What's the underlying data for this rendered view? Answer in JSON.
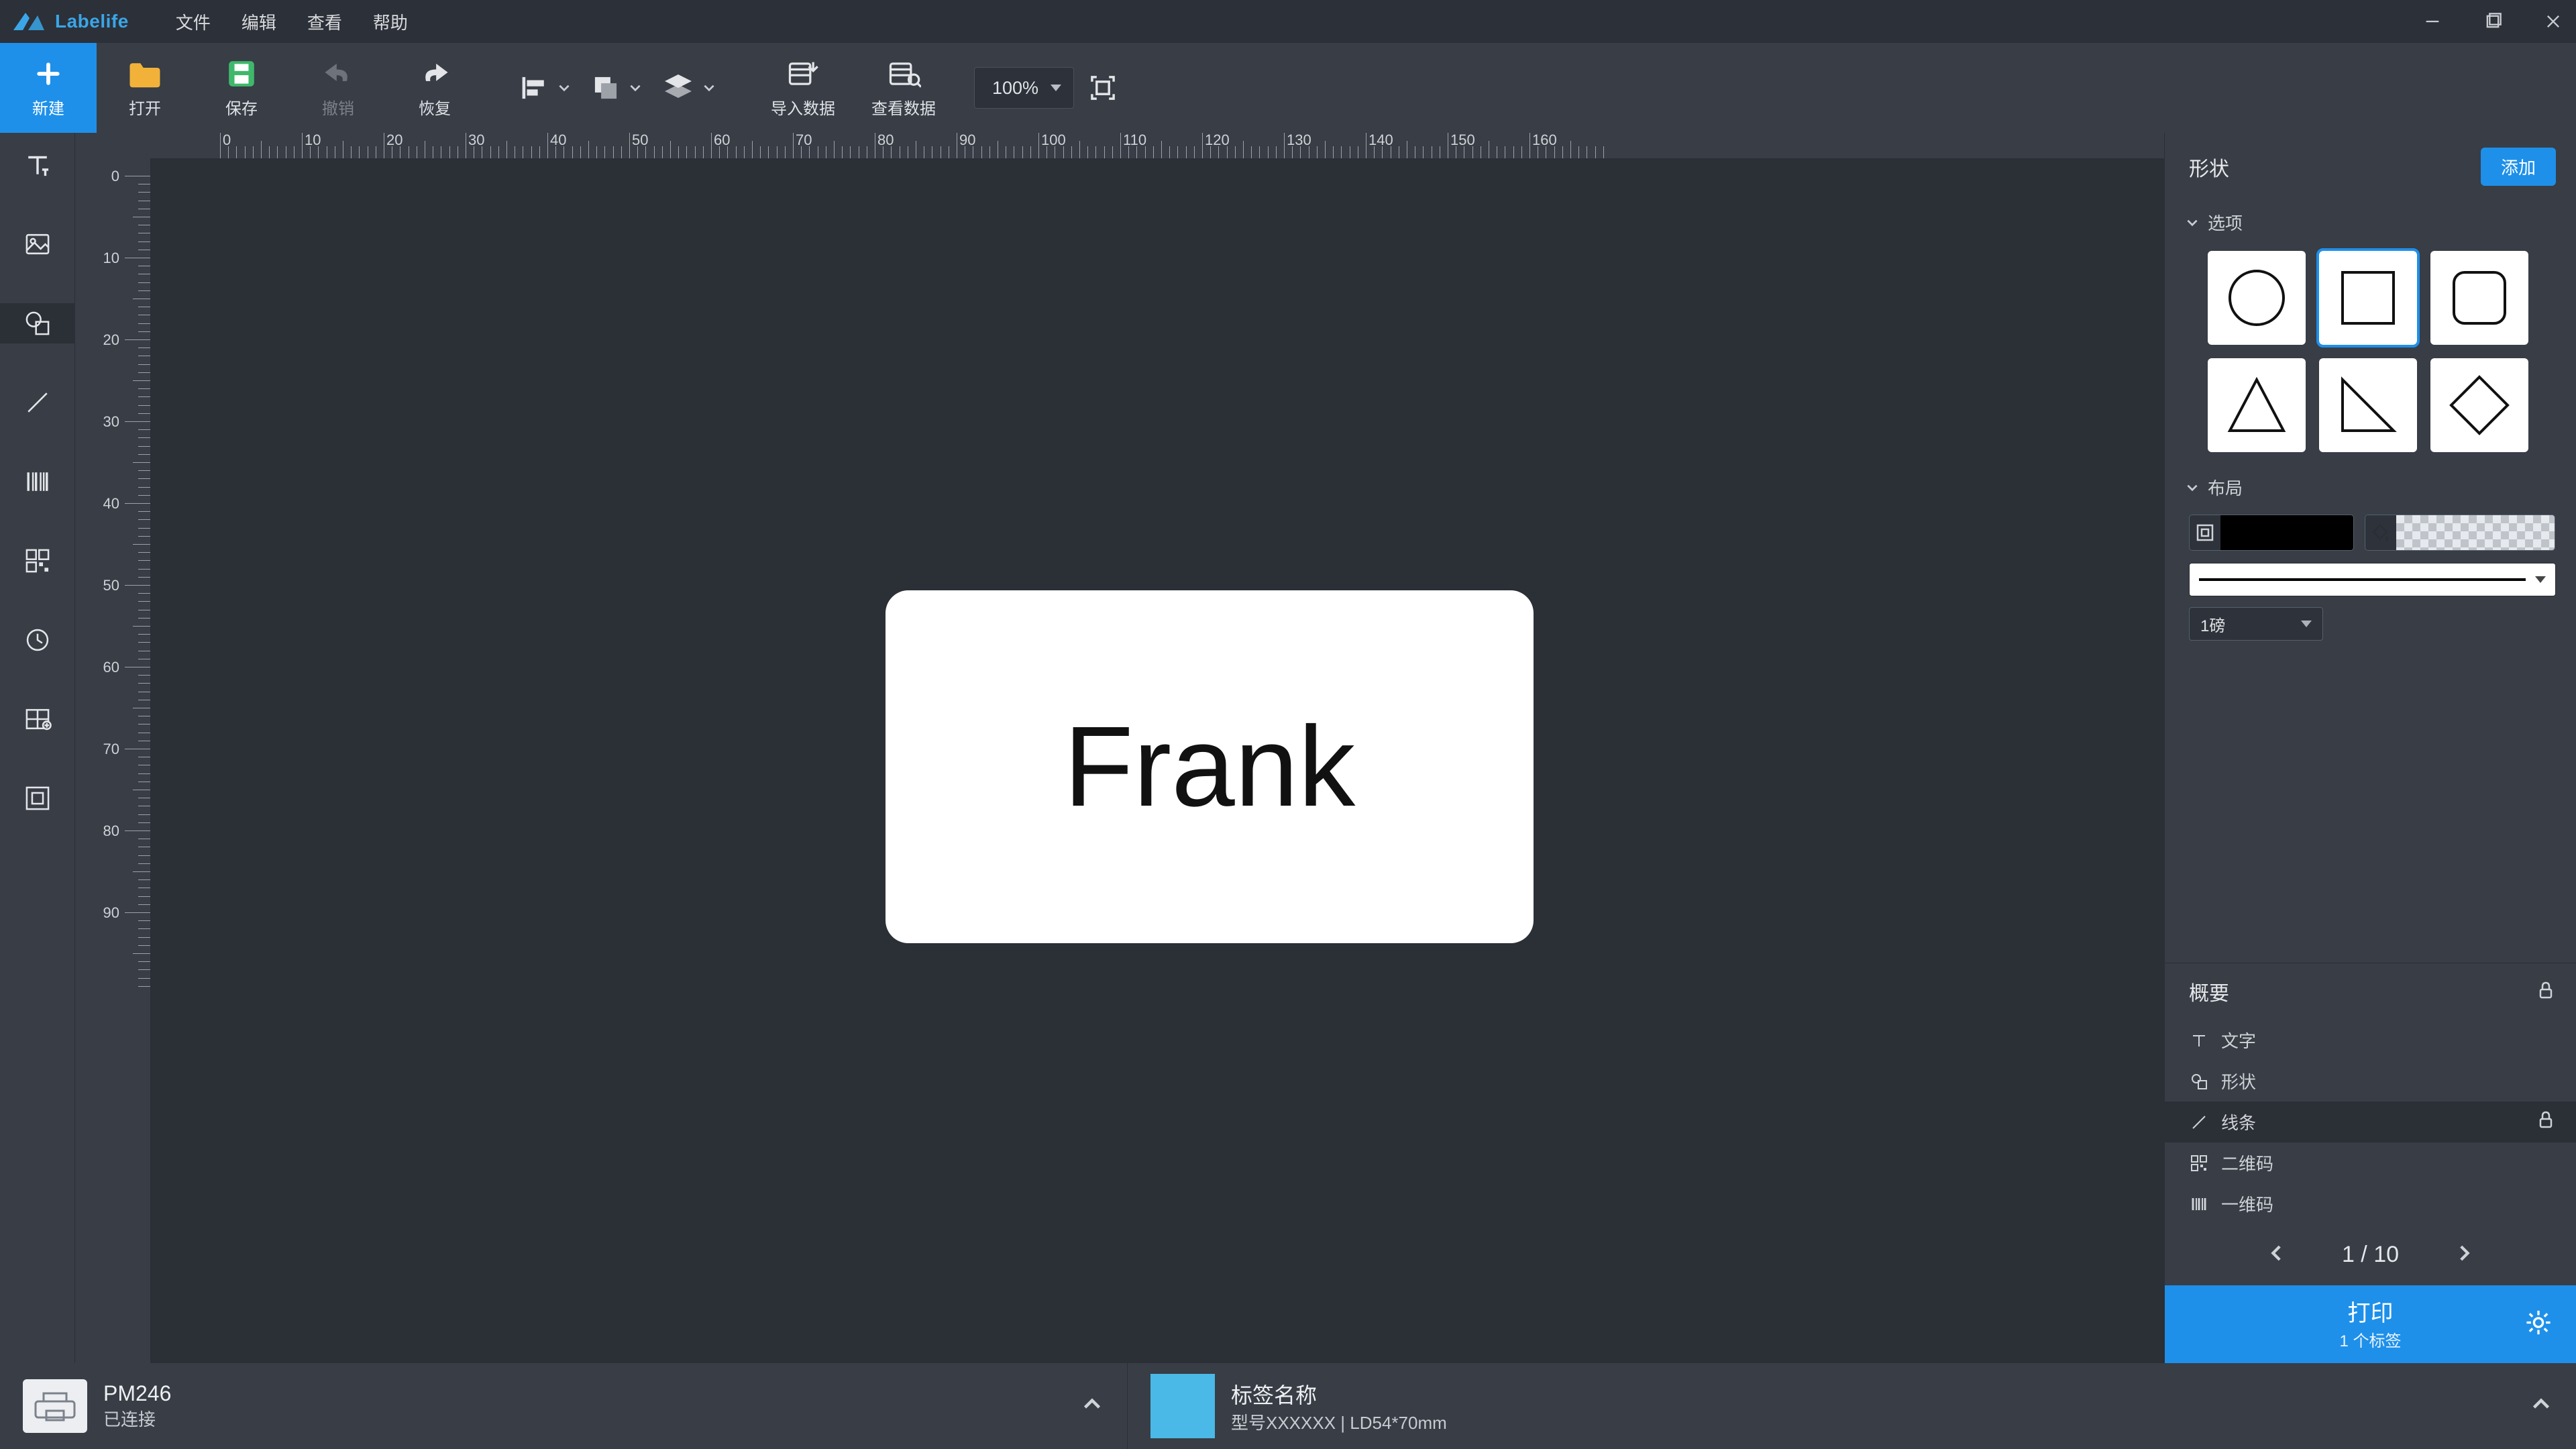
{
  "app": {
    "name": "Labelife"
  },
  "menu": {
    "file": "文件",
    "edit": "编辑",
    "view": "查看",
    "help": "帮助"
  },
  "toolbar": {
    "new": "新建",
    "open": "打开",
    "save": "保存",
    "undo": "撤销",
    "redo": "恢复",
    "import": "导入数据",
    "viewdata": "查看数据",
    "zoom": "100%"
  },
  "ruler_h": [
    "0",
    "10",
    "20",
    "30",
    "40",
    "50",
    "60",
    "70",
    "80",
    "90",
    "100",
    "110",
    "120",
    "130",
    "140",
    "150",
    "160"
  ],
  "ruler_v": [
    "0",
    "10",
    "20",
    "30",
    "40",
    "50",
    "60",
    "70",
    "80",
    "90"
  ],
  "canvas": {
    "text": "Frank"
  },
  "right": {
    "title": "形状",
    "add": "添加",
    "options": "选项",
    "layout": "布局",
    "thickness": "1磅",
    "outline_title": "概要",
    "outline": {
      "text": "文字",
      "shape": "形状",
      "line": "线条",
      "qr": "二维码",
      "bar": "一维码"
    },
    "page": "1 / 10",
    "print": "打印",
    "print_sub": "1 个标签"
  },
  "footer": {
    "device_name": "PM246",
    "device_status": "已连接",
    "label_title": "标签名称",
    "label_sub": "型号XXXXXX  |  LD54*70mm"
  }
}
